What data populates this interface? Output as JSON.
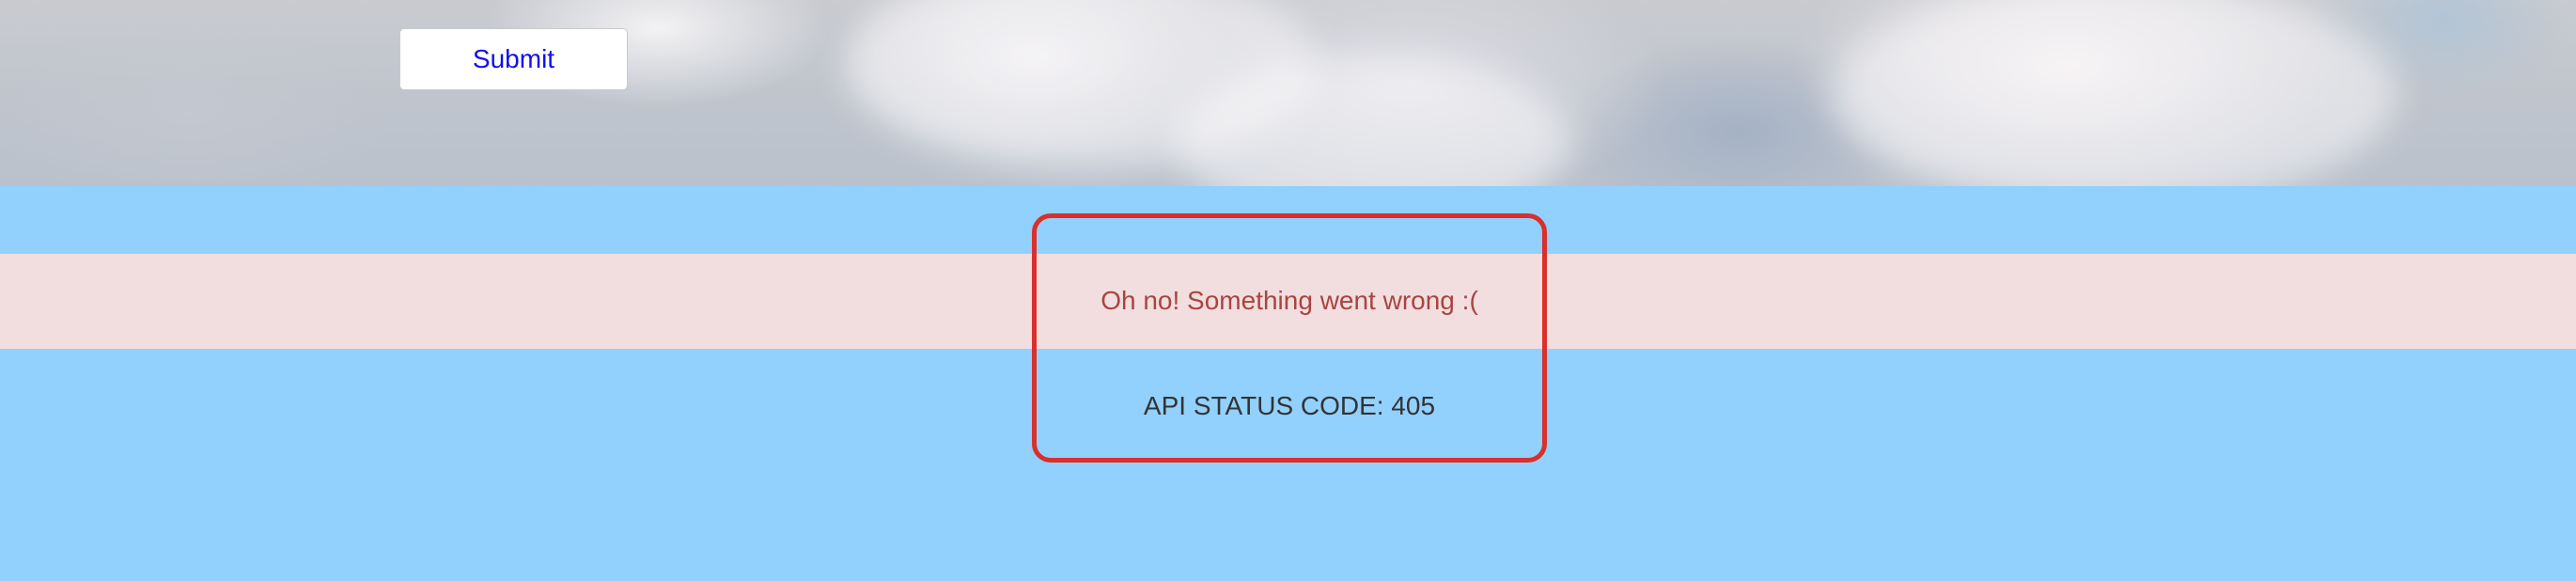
{
  "form": {
    "submit_label": "Submit"
  },
  "error": {
    "message": "Oh no! Something went wrong :(",
    "status_text": "API STATUS CODE: 405"
  },
  "colors": {
    "page_background": "#92d1fd",
    "error_band": "#f2dede",
    "error_text": "#a94442",
    "error_border": "#d9302b",
    "submit_text": "#1010ee"
  }
}
